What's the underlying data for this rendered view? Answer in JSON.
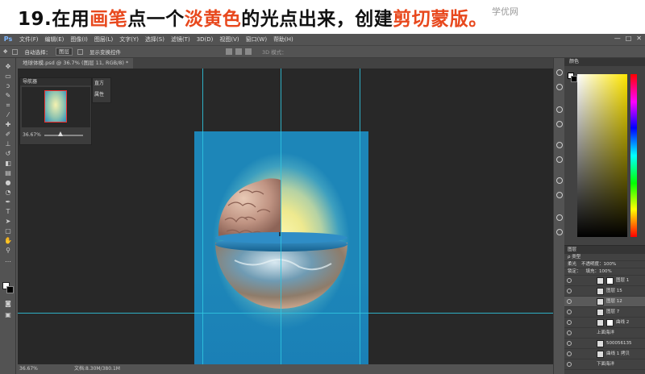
{
  "banner": {
    "step": "19.",
    "part1": "在用",
    "part2": "画笔",
    "part3": "点一个",
    "part4": "淡黄色",
    "part5": "的光点出来，创建",
    "part6": "剪切蒙版",
    "part7": "。",
    "watermark": "学优网"
  },
  "menubar": {
    "logo": "Ps",
    "items": [
      "文件(F)",
      "编辑(E)",
      "图像(I)",
      "图层(L)",
      "文字(Y)",
      "选择(S)",
      "滤镜(T)",
      "3D(D)",
      "视图(V)",
      "窗口(W)",
      "帮助(H)"
    ]
  },
  "options": {
    "auto_select_label": "自动选择：",
    "auto_select_value": "图层",
    "show_transform_label": "显示变换控件",
    "mode_3d": "3D 模式："
  },
  "document_tab": {
    "label": "地球体模.psd @ 36.7% (图层 11, RGB/8) *"
  },
  "navigator": {
    "title": "导航器",
    "zoom": "36.67%",
    "side_items": [
      "直方",
      "属性"
    ]
  },
  "status": {
    "zoom": "36.67%",
    "doc_size": "文档:8.30M/380.1M"
  },
  "color_panel": {
    "title": "颜色",
    "fg_color": "#ffffff",
    "bg_color": "#000000",
    "hue_color": "#ffe600"
  },
  "layers_panel": {
    "title": "图层",
    "filter_label": "ρ 类型",
    "blend_mode": "柔光",
    "opacity_label": "不透明度：100%",
    "lock_label": "锁定：",
    "fill_label": "填充：100%",
    "rows": [
      {
        "name": "图层 1",
        "type": "layer",
        "selected": false
      },
      {
        "name": "图层 15",
        "type": "layer",
        "selected": false
      },
      {
        "name": "图层 12",
        "type": "layer",
        "selected": true
      },
      {
        "name": "图层 7",
        "type": "layer",
        "selected": false
      },
      {
        "name": "曲线 2",
        "type": "layer",
        "selected": false
      },
      {
        "name": "上面海洋",
        "type": "group",
        "selected": false
      },
      {
        "name": "500056135",
        "type": "layer",
        "selected": false
      },
      {
        "name": "曲线 1 拷贝",
        "type": "layer",
        "selected": false
      },
      {
        "name": "下面海洋",
        "type": "group",
        "selected": false
      }
    ]
  }
}
